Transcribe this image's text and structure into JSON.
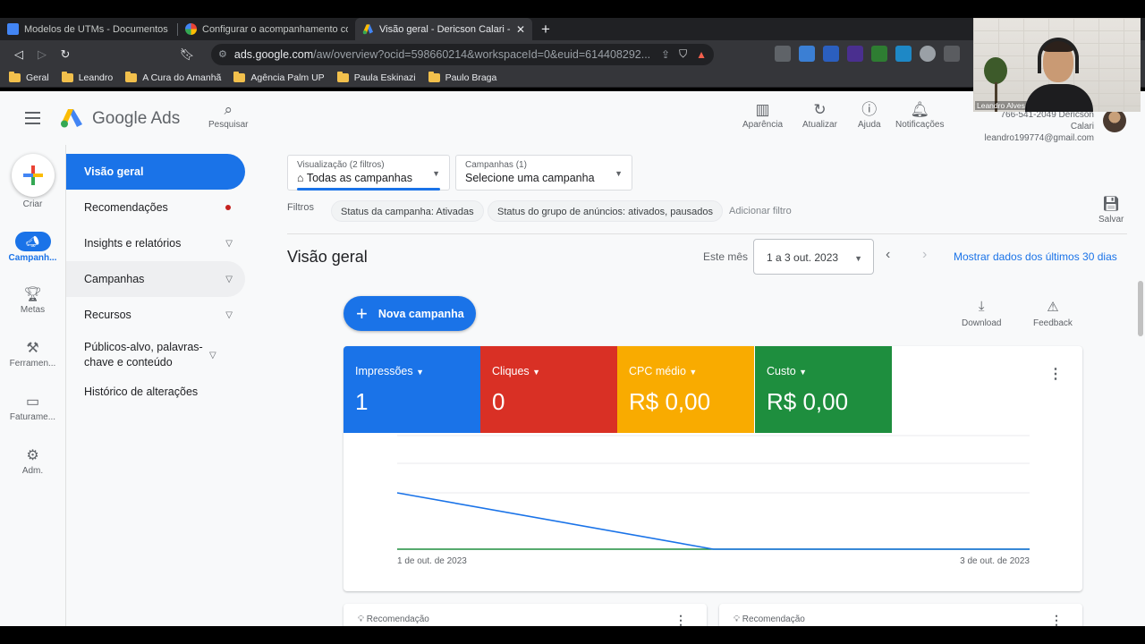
{
  "browser": {
    "tabs": [
      {
        "title": "Modelos de UTMs - Documentos Goo",
        "icon": "docs-icon",
        "active": false
      },
      {
        "title": "Configurar o acompanhamento com p",
        "icon": "google-icon",
        "active": false
      },
      {
        "title": "Visão geral - Dericson Calari - Go",
        "icon": "ads-icon",
        "active": true
      }
    ],
    "url_host": "ads.google.com",
    "url_rest": "/aw/overview?ocid=598660214&workspaceId=0&euid=614408292...",
    "bookmarks": [
      "Geral",
      "Leandro",
      "A Cura do Amanhã",
      "Agência Palm UP",
      "Paula Eskinazi",
      "Paulo Braga"
    ]
  },
  "header": {
    "brand": "Google Ads",
    "search_label": "Pesquisar",
    "actions": [
      "Aparência",
      "Atualizar",
      "Ajuda",
      "Notificações"
    ],
    "account_line1": "766-541-2049 Dericson Calari",
    "account_email": "leandro199774@gmail.com"
  },
  "webcam": {
    "name": "Leandro Alves"
  },
  "rail": [
    {
      "label": "Criar"
    },
    {
      "label": "Campanh..."
    },
    {
      "label": "Metas"
    },
    {
      "label": "Ferramen..."
    },
    {
      "label": "Faturame..."
    },
    {
      "label": "Adm."
    }
  ],
  "nav": [
    {
      "label": "Visão geral"
    },
    {
      "label": "Recomendações"
    },
    {
      "label": "Insights e relatórios"
    },
    {
      "label": "Campanhas"
    },
    {
      "label": "Recursos"
    },
    {
      "label": "Públicos-alvo, palavras-chave e conteúdo"
    },
    {
      "label": "Histórico de alterações"
    }
  ],
  "filters": {
    "view_small": "Visualização (2 filtros)",
    "view_value": "Todas as campanhas",
    "campaign_small": "Campanhas (1)",
    "campaign_value": "Selecione uma campanha",
    "label": "Filtros",
    "chips": [
      "Status da campanha: Ativadas",
      "Status do grupo de anúncios: ativados, pausados"
    ],
    "add": "Adicionar filtro",
    "save": "Salvar"
  },
  "main": {
    "title": "Visão geral",
    "period_label": "Este mês",
    "period_value": "1 a 3 out. 2023",
    "last30": "Mostrar dados dos últimos 30 dias",
    "new_campaign": "Nova campanha",
    "download": "Download",
    "feedback": "Feedback",
    "recommendation": "Recomendação"
  },
  "metrics": [
    {
      "name": "Impressões",
      "value": "1",
      "color": "#1a73e8"
    },
    {
      "name": "Cliques",
      "value": "0",
      "color": "#d93025"
    },
    {
      "name": "CPC médio",
      "value": "R$ 0,00",
      "color": "#f9ab00"
    },
    {
      "name": "Custo",
      "value": "R$ 0,00",
      "color": "#1e8e3e"
    }
  ],
  "chart_data": {
    "type": "line",
    "x": [
      "1 de out. de 2023",
      "2 de out. de 2023",
      "3 de out. de 2023"
    ],
    "x_tick_labels": [
      "1 de out. de 2023",
      "3 de out. de 2023"
    ],
    "series": [
      {
        "values": [
          1,
          0,
          0
        ],
        "color": "#1a73e8"
      },
      {
        "values": [
          0,
          0,
          0
        ],
        "color": "#1e8e3e"
      }
    ],
    "ylim": [
      0,
      1
    ]
  }
}
